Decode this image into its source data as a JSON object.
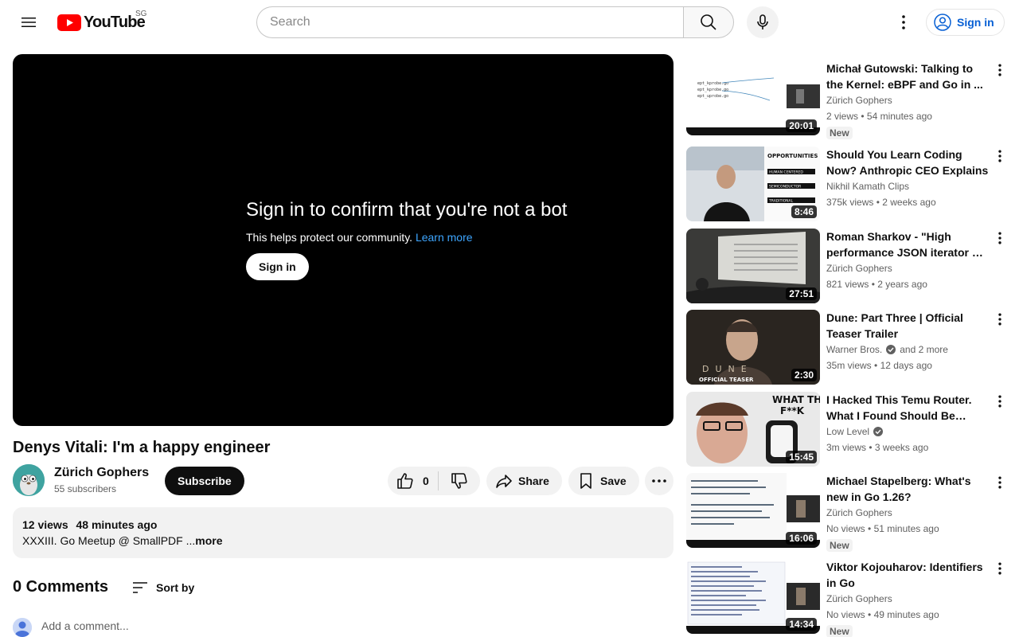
{
  "header": {
    "logo_text": "YouTube",
    "country_code": "SG",
    "search_placeholder": "Search",
    "signin_label": "Sign in"
  },
  "player": {
    "bot_title": "Sign in to confirm that you're not a bot",
    "bot_sub": "This helps protect our community.",
    "learn_more": "Learn more",
    "signin_label": "Sign in"
  },
  "video": {
    "title": "Denys Vitali: I'm a happy engineer",
    "channel": "Zürich Gophers",
    "subscribers": "55 subscribers",
    "subscribe_label": "Subscribe",
    "likes": "0",
    "share_label": "Share",
    "save_label": "Save",
    "views": "12 views",
    "time": "48 minutes ago",
    "description": "XXXIII. Go Meetup @ SmallPDF ...",
    "more_label": "more"
  },
  "comments": {
    "count_label": "0 Comments",
    "sort_label": "Sort by",
    "add_placeholder": "Add a comment..."
  },
  "colors": {
    "accent_blue": "#065fd4",
    "youtube_red": "#ff0000",
    "link_blue": "#3ea6ff"
  },
  "recommendations": [
    {
      "title": "Michał Gutowski: Talking to the Kernel: eBPF and Go in ...",
      "channel": "Zürich Gophers",
      "verified": false,
      "extra": "",
      "views": "2 views",
      "age": "54 minutes ago",
      "badge": "New",
      "duration": "20:01"
    },
    {
      "title": "Should You Learn Coding Now? Anthropic CEO Explains",
      "channel": "Nikhil Kamath Clips",
      "verified": false,
      "extra": "",
      "views": "375k views",
      "age": "2 weeks ago",
      "badge": "",
      "duration": "8:46"
    },
    {
      "title": "Roman Sharkov - \"High performance JSON iterator & ...",
      "channel": "Zürich Gophers",
      "verified": false,
      "extra": "",
      "views": "821 views",
      "age": "2 years ago",
      "badge": "",
      "duration": "27:51"
    },
    {
      "title": "Dune: Part Three | Official Teaser Trailer",
      "channel": "Warner Bros.",
      "verified": true,
      "extra": "and 2 more",
      "views": "35m views",
      "age": "12 days ago",
      "badge": "",
      "duration": "2:30"
    },
    {
      "title": "I Hacked This Temu Router. What I Found Should Be Illegal.",
      "channel": "Low Level",
      "verified": true,
      "extra": "",
      "views": "3m views",
      "age": "3 weeks ago",
      "badge": "",
      "duration": "15:45"
    },
    {
      "title": "Michael Stapelberg: What's new in Go 1.26?",
      "channel": "Zürich Gophers",
      "verified": false,
      "extra": "",
      "views": "No views",
      "age": "51 minutes ago",
      "badge": "New",
      "duration": "16:06"
    },
    {
      "title": "Viktor Kojouharov: Identifiers in Go",
      "channel": "Zürich Gophers",
      "verified": false,
      "extra": "",
      "views": "No views",
      "age": "49 minutes ago",
      "badge": "New",
      "duration": "14:34"
    }
  ],
  "thumb_text": {
    "rec1": [
      "ept_kprobe.go",
      "ept_kprobe.go",
      "ept_uprobe.go"
    ],
    "rec2": [
      "OPPORTUNITIES",
      "HUMAN CENTERED",
      "SEMICONDUCTOR",
      "TRADITIONAL"
    ],
    "rec4": [
      "DUNE",
      "OFFICIAL TEASER"
    ],
    "rec5": [
      "WHAT THE",
      "F**K"
    ]
  }
}
